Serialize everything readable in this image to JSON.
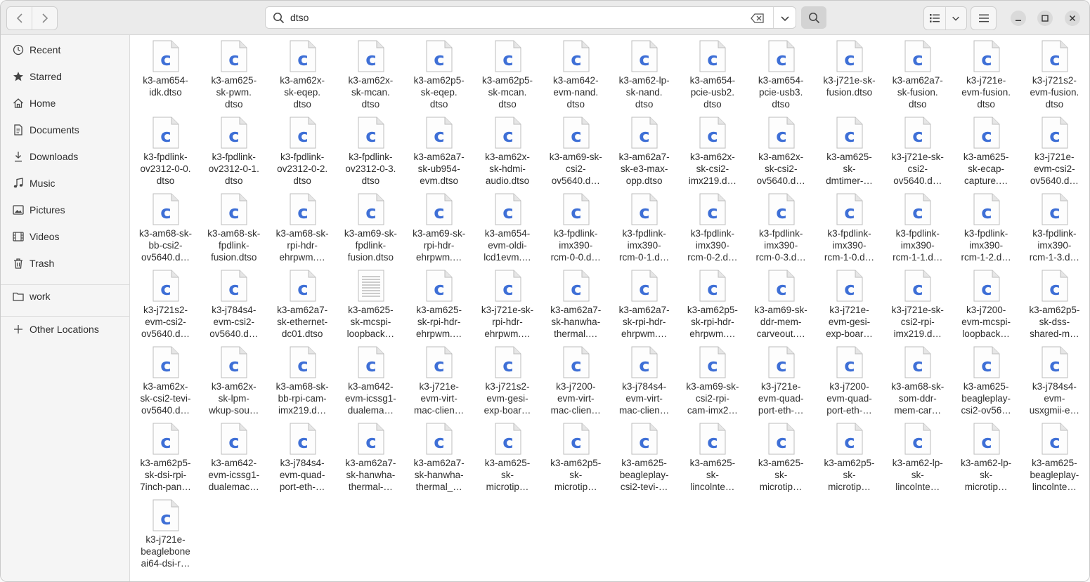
{
  "search": {
    "query": "dtso"
  },
  "sidebar": {
    "items": [
      {
        "label": "Recent",
        "icon": "clock-icon"
      },
      {
        "label": "Starred",
        "icon": "star-icon"
      },
      {
        "label": "Home",
        "icon": "home-icon"
      },
      {
        "label": "Documents",
        "icon": "document-icon"
      },
      {
        "label": "Downloads",
        "icon": "download-icon"
      },
      {
        "label": "Music",
        "icon": "music-icon"
      },
      {
        "label": "Pictures",
        "icon": "picture-icon"
      },
      {
        "label": "Videos",
        "icon": "video-icon"
      },
      {
        "label": "Trash",
        "icon": "trash-icon"
      }
    ],
    "bookmarks": [
      {
        "label": "work",
        "icon": "folder-icon"
      }
    ],
    "other": {
      "label": "Other Locations",
      "icon": "plus-icon"
    }
  },
  "colors": {
    "c_glyph": "#3e6fd6",
    "accent": "#3584e4"
  },
  "files": [
    {
      "name": "k3-am654-\nidk.dtso",
      "type": "c"
    },
    {
      "name": "k3-am625-\nsk-pwm.\ndtso",
      "type": "c"
    },
    {
      "name": "k3-am62x-\nsk-eqep.\ndtso",
      "type": "c"
    },
    {
      "name": "k3-am62x-\nsk-mcan.\ndtso",
      "type": "c"
    },
    {
      "name": "k3-am62p5-\nsk-eqep.\ndtso",
      "type": "c"
    },
    {
      "name": "k3-am62p5-\nsk-mcan.\ndtso",
      "type": "c"
    },
    {
      "name": "k3-am642-\nevm-nand.\ndtso",
      "type": "c"
    },
    {
      "name": "k3-am62-lp-\nsk-nand.\ndtso",
      "type": "c"
    },
    {
      "name": "k3-am654-\npcie-usb2.\ndtso",
      "type": "c"
    },
    {
      "name": "k3-am654-\npcie-usb3.\ndtso",
      "type": "c"
    },
    {
      "name": "k3-j721e-sk-\nfusion.dtso",
      "type": "c"
    },
    {
      "name": "k3-am62a7-\nsk-fusion.\ndtso",
      "type": "c"
    },
    {
      "name": "k3-j721e-\nevm-fusion.\ndtso",
      "type": "c"
    },
    {
      "name": "k3-j721s2-\nevm-fusion.\ndtso",
      "type": "c"
    },
    {
      "name": "k3-fpdlink-\nov2312-0-0.\ndtso",
      "type": "c"
    },
    {
      "name": "k3-fpdlink-\nov2312-0-1.\ndtso",
      "type": "c"
    },
    {
      "name": "k3-fpdlink-\nov2312-0-2.\ndtso",
      "type": "c"
    },
    {
      "name": "k3-fpdlink-\nov2312-0-3.\ndtso",
      "type": "c"
    },
    {
      "name": "k3-am62a7-\nsk-ub954-\nevm.dtso",
      "type": "c"
    },
    {
      "name": "k3-am62x-\nsk-hdmi-\naudio.dtso",
      "type": "c"
    },
    {
      "name": "k3-am69-sk-\ncsi2-\nov5640.d…",
      "type": "c"
    },
    {
      "name": "k3-am62a7-\nsk-e3-max-\nopp.dtso",
      "type": "c"
    },
    {
      "name": "k3-am62x-\nsk-csi2-\nimx219.d…",
      "type": "c"
    },
    {
      "name": "k3-am62x-\nsk-csi2-\nov5640.d…",
      "type": "c"
    },
    {
      "name": "k3-am625-\nsk-\ndmtimer-…",
      "type": "c"
    },
    {
      "name": "k3-j721e-sk-\ncsi2-\nov5640.d…",
      "type": "c"
    },
    {
      "name": "k3-am625-\nsk-ecap-\ncapture.…",
      "type": "c"
    },
    {
      "name": "k3-j721e-\nevm-csi2-\nov5640.d…",
      "type": "c"
    },
    {
      "name": "k3-am68-sk-\nbb-csi2-\nov5640.d…",
      "type": "c"
    },
    {
      "name": "k3-am68-sk-\nfpdlink-\nfusion.dtso",
      "type": "c"
    },
    {
      "name": "k3-am68-sk-\nrpi-hdr-\nehrpwm.…",
      "type": "c"
    },
    {
      "name": "k3-am69-sk-\nfpdlink-\nfusion.dtso",
      "type": "c"
    },
    {
      "name": "k3-am69-sk-\nrpi-hdr-\nehrpwm.…",
      "type": "c"
    },
    {
      "name": "k3-am654-\nevm-oldi-\nlcd1evm.…",
      "type": "c"
    },
    {
      "name": "k3-fpdlink-\nimx390-\nrcm-0-0.d…",
      "type": "c"
    },
    {
      "name": "k3-fpdlink-\nimx390-\nrcm-0-1.d…",
      "type": "c"
    },
    {
      "name": "k3-fpdlink-\nimx390-\nrcm-0-2.d…",
      "type": "c"
    },
    {
      "name": "k3-fpdlink-\nimx390-\nrcm-0-3.d…",
      "type": "c"
    },
    {
      "name": "k3-fpdlink-\nimx390-\nrcm-1-0.d…",
      "type": "c"
    },
    {
      "name": "k3-fpdlink-\nimx390-\nrcm-1-1.d…",
      "type": "c"
    },
    {
      "name": "k3-fpdlink-\nimx390-\nrcm-1-2.d…",
      "type": "c"
    },
    {
      "name": "k3-fpdlink-\nimx390-\nrcm-1-3.d…",
      "type": "c"
    },
    {
      "name": "k3-j721s2-\nevm-csi2-\nov5640.d…",
      "type": "c"
    },
    {
      "name": "k3-j784s4-\nevm-csi2-\nov5640.d…",
      "type": "c"
    },
    {
      "name": "k3-am62a7-\nsk-ethernet-\ndc01.dtso",
      "type": "c"
    },
    {
      "name": "k3-am625-\nsk-mcspi-\nloopback…",
      "type": "text"
    },
    {
      "name": "k3-am625-\nsk-rpi-hdr-\nehrpwm.…",
      "type": "c"
    },
    {
      "name": "k3-j721e-sk-\nrpi-hdr-\nehrpwm.…",
      "type": "c"
    },
    {
      "name": "k3-am62a7-\nsk-hanwha-\nthermal.…",
      "type": "c"
    },
    {
      "name": "k3-am62a7-\nsk-rpi-hdr-\nehrpwm.…",
      "type": "c"
    },
    {
      "name": "k3-am62p5-\nsk-rpi-hdr-\nehrpwm.…",
      "type": "c"
    },
    {
      "name": "k3-am69-sk-\nddr-mem-\ncarveout.…",
      "type": "c"
    },
    {
      "name": "k3-j721e-\nevm-gesi-\nexp-boar…",
      "type": "c"
    },
    {
      "name": "k3-j721e-sk-\ncsi2-rpi-\nimx219.d…",
      "type": "c"
    },
    {
      "name": "k3-j7200-\nevm-mcspi-\nloopback…",
      "type": "c"
    },
    {
      "name": "k3-am62p5-\nsk-dss-\nshared-m…",
      "type": "c"
    },
    {
      "name": "k3-am62x-\nsk-csi2-tevi-\nov5640.d…",
      "type": "c"
    },
    {
      "name": "k3-am62x-\nsk-lpm-\nwkup-sou…",
      "type": "c"
    },
    {
      "name": "k3-am68-sk-\nbb-rpi-cam-\nimx219.d…",
      "type": "c"
    },
    {
      "name": "k3-am642-\nevm-icssg1-\ndualema…",
      "type": "c"
    },
    {
      "name": "k3-j721e-\nevm-virt-\nmac-clien…",
      "type": "c"
    },
    {
      "name": "k3-j721s2-\nevm-gesi-\nexp-boar…",
      "type": "c"
    },
    {
      "name": "k3-j7200-\nevm-virt-\nmac-clien…",
      "type": "c"
    },
    {
      "name": "k3-j784s4-\nevm-virt-\nmac-clien…",
      "type": "c"
    },
    {
      "name": "k3-am69-sk-\ncsi2-rpi-\ncam-imx2…",
      "type": "c"
    },
    {
      "name": "k3-j721e-\nevm-quad-\nport-eth-…",
      "type": "c"
    },
    {
      "name": "k3-j7200-\nevm-quad-\nport-eth-…",
      "type": "c"
    },
    {
      "name": "k3-am68-sk-\nsom-ddr-\nmem-car…",
      "type": "c"
    },
    {
      "name": "k3-am625-\nbeagleplay-\ncsi2-ov56…",
      "type": "c"
    },
    {
      "name": "k3-j784s4-\nevm-\nusxgmii-e…",
      "type": "c"
    },
    {
      "name": "k3-am62p5-\nsk-dsi-rpi-\n7inch-pan…",
      "type": "c"
    },
    {
      "name": "k3-am642-\nevm-icssg1-\ndualemac…",
      "type": "c"
    },
    {
      "name": "k3-j784s4-\nevm-quad-\nport-eth-…",
      "type": "c"
    },
    {
      "name": "k3-am62a7-\nsk-hanwha-\nthermal-…",
      "type": "c"
    },
    {
      "name": "k3-am62a7-\nsk-hanwha-\nthermal_…",
      "type": "c"
    },
    {
      "name": "k3-am625-\nsk-\nmicrotip…",
      "type": "c"
    },
    {
      "name": "k3-am62p5-\nsk-\nmicrotip…",
      "type": "c"
    },
    {
      "name": "k3-am625-\nbeagleplay-\ncsi2-tevi-…",
      "type": "c"
    },
    {
      "name": "k3-am625-\nsk-\nlincolnte…",
      "type": "c"
    },
    {
      "name": "k3-am625-\nsk-\nmicrotip…",
      "type": "c"
    },
    {
      "name": "k3-am62p5-\nsk-\nmicrotip…",
      "type": "c"
    },
    {
      "name": "k3-am62-lp-\nsk-\nlincolnte…",
      "type": "c"
    },
    {
      "name": "k3-am62-lp-\nsk-\nmicrotip…",
      "type": "c"
    },
    {
      "name": "k3-am625-\nbeagleplay-\nlincolnte…",
      "type": "c"
    },
    {
      "name": "k3-j721e-\nbeaglebone\nai64-dsi-r…",
      "type": "c"
    }
  ]
}
